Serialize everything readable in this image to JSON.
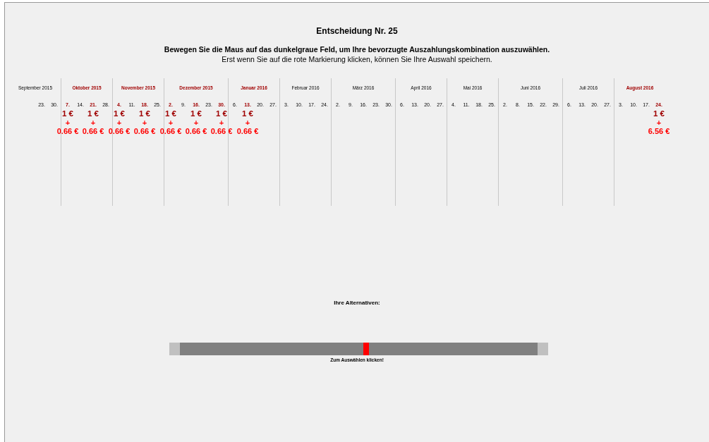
{
  "title": "Entscheidung Nr. 25",
  "instruction": "Bewegen Sie die Maus auf das dunkelgraue Feld, um Ihre bevorzugte Auszahlungskombination auszuwählen.",
  "hint": "Erst wenn Sie auf die rote Markierung klicken, können Sie Ihre Auswahl speichern.",
  "months": [
    {
      "label": "September 2015",
      "selected": false,
      "weeks": [
        {
          "label": "23.",
          "selected": false
        },
        {
          "label": "30.",
          "selected": false
        }
      ]
    },
    {
      "label": "Oktober 2015",
      "selected": true,
      "weeks": [
        {
          "label": "7.",
          "selected": true,
          "payment": {
            "base": "1 €",
            "plus": "+",
            "bonus": "0.66 €"
          }
        },
        {
          "label": "14.",
          "selected": false
        },
        {
          "label": "21.",
          "selected": true,
          "payment": {
            "base": "1 €",
            "plus": "+",
            "bonus": "0.66 €"
          }
        },
        {
          "label": "28.",
          "selected": false
        }
      ]
    },
    {
      "label": "November 2015",
      "selected": true,
      "weeks": [
        {
          "label": "4.",
          "selected": true,
          "payment": {
            "base": "1 €",
            "plus": "+",
            "bonus": "0.66 €"
          }
        },
        {
          "label": "11.",
          "selected": false
        },
        {
          "label": "18.",
          "selected": true,
          "payment": {
            "base": "1 €",
            "plus": "+",
            "bonus": "0.66 €"
          }
        },
        {
          "label": "25.",
          "selected": false
        }
      ]
    },
    {
      "label": "Dezember 2015",
      "selected": true,
      "weeks": [
        {
          "label": "2.",
          "selected": true,
          "payment": {
            "base": "1 €",
            "plus": "+",
            "bonus": "0.66 €"
          }
        },
        {
          "label": "9.",
          "selected": false
        },
        {
          "label": "16.",
          "selected": true,
          "payment": {
            "base": "1 €",
            "plus": "+",
            "bonus": "0.66 €"
          }
        },
        {
          "label": "23.",
          "selected": false
        },
        {
          "label": "30.",
          "selected": true,
          "payment": {
            "base": "1 €",
            "plus": "+",
            "bonus": "0.66 €"
          }
        }
      ]
    },
    {
      "label": "Januar 2016",
      "selected": true,
      "weeks": [
        {
          "label": "6.",
          "selected": false
        },
        {
          "label": "13.",
          "selected": true,
          "payment": {
            "base": "1 €",
            "plus": "+",
            "bonus": "0.66 €"
          }
        },
        {
          "label": "20.",
          "selected": false
        },
        {
          "label": "27.",
          "selected": false
        }
      ]
    },
    {
      "label": "Februar 2016",
      "selected": false,
      "weeks": [
        {
          "label": "3.",
          "selected": false
        },
        {
          "label": "10.",
          "selected": false
        },
        {
          "label": "17.",
          "selected": false
        },
        {
          "label": "24.",
          "selected": false
        }
      ]
    },
    {
      "label": "März 2016",
      "selected": false,
      "weeks": [
        {
          "label": "2.",
          "selected": false
        },
        {
          "label": "9.",
          "selected": false
        },
        {
          "label": "16.",
          "selected": false
        },
        {
          "label": "23.",
          "selected": false
        },
        {
          "label": "30.",
          "selected": false
        }
      ]
    },
    {
      "label": "April 2016",
      "selected": false,
      "weeks": [
        {
          "label": "6.",
          "selected": false
        },
        {
          "label": "13.",
          "selected": false
        },
        {
          "label": "20.",
          "selected": false
        },
        {
          "label": "27.",
          "selected": false
        }
      ]
    },
    {
      "label": "Mai 2016",
      "selected": false,
      "weeks": [
        {
          "label": "4.",
          "selected": false
        },
        {
          "label": "11.",
          "selected": false
        },
        {
          "label": "18.",
          "selected": false
        },
        {
          "label": "25.",
          "selected": false
        }
      ]
    },
    {
      "label": "Juni 2016",
      "selected": false,
      "weeks": [
        {
          "label": "2.",
          "selected": false
        },
        {
          "label": "8.",
          "selected": false
        },
        {
          "label": "15.",
          "selected": false
        },
        {
          "label": "22.",
          "selected": false
        },
        {
          "label": "29.",
          "selected": false
        }
      ]
    },
    {
      "label": "Juli 2016",
      "selected": false,
      "weeks": [
        {
          "label": "6.",
          "selected": false
        },
        {
          "label": "13.",
          "selected": false
        },
        {
          "label": "20.",
          "selected": false
        },
        {
          "label": "27.",
          "selected": false
        }
      ]
    },
    {
      "label": "August 2016",
      "selected": true,
      "weeks": [
        {
          "label": "3.",
          "selected": false
        },
        {
          "label": "10.",
          "selected": false
        },
        {
          "label": "17.",
          "selected": false
        },
        {
          "label": "24.",
          "selected": true,
          "payment": {
            "base": "1 €",
            "plus": "+",
            "bonus": "6.56 €"
          }
        }
      ]
    }
  ],
  "alternatives": {
    "label": "Ihre Alternativen:",
    "level": 0.52,
    "caption": "Zum Auswählen klicken!"
  }
}
